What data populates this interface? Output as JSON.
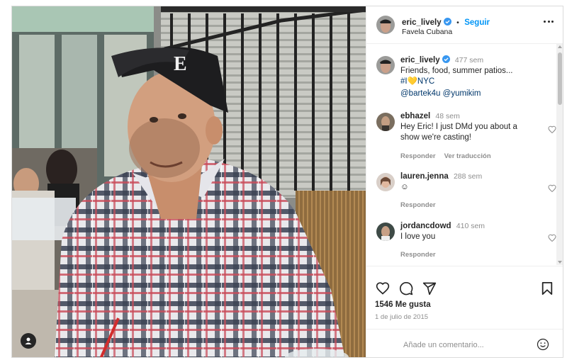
{
  "post": {
    "author": "eric_lively",
    "follow_label": "Seguir",
    "separator": "•",
    "location": "Favela Cubana",
    "caption": {
      "username": "eric_lively",
      "time": "477 sem",
      "line1": "Friends, food, summer patios...",
      "line2_prefix": "#I",
      "heart_emoji": "💛",
      "line2_suffix": "NYC",
      "mention1": "@bartek4u",
      "mention2": "@yumikim"
    },
    "likes": "1546 Me gusta",
    "date": "1 de julio de 2015",
    "comment_placeholder": "Añade un comentario..."
  },
  "comments": [
    {
      "username": "ebhazel",
      "time": "48 sem",
      "text_line1": "Hey Eric! I just DMd you about a",
      "text_line2": "show we're casting!",
      "reply": "Responder",
      "translate": "Ver traducción"
    },
    {
      "username": "lauren.jenna",
      "time": "288 sem",
      "text_line1": "☺",
      "reply": "Responder"
    },
    {
      "username": "jordancdowd",
      "time": "410 sem",
      "text_line1": "I love you",
      "reply": "Responder"
    }
  ],
  "icons": {
    "verified": "verified-badge-icon",
    "more": "more-options-icon",
    "like": "heart-icon",
    "comment": "comment-icon",
    "share": "share-icon",
    "save": "bookmark-icon",
    "emoji": "emoji-icon",
    "tag": "user-tag-icon"
  },
  "colors": {
    "accent": "#0095f6",
    "verified": "#3897f0",
    "muted": "#8e8e8e",
    "text": "#262626"
  }
}
